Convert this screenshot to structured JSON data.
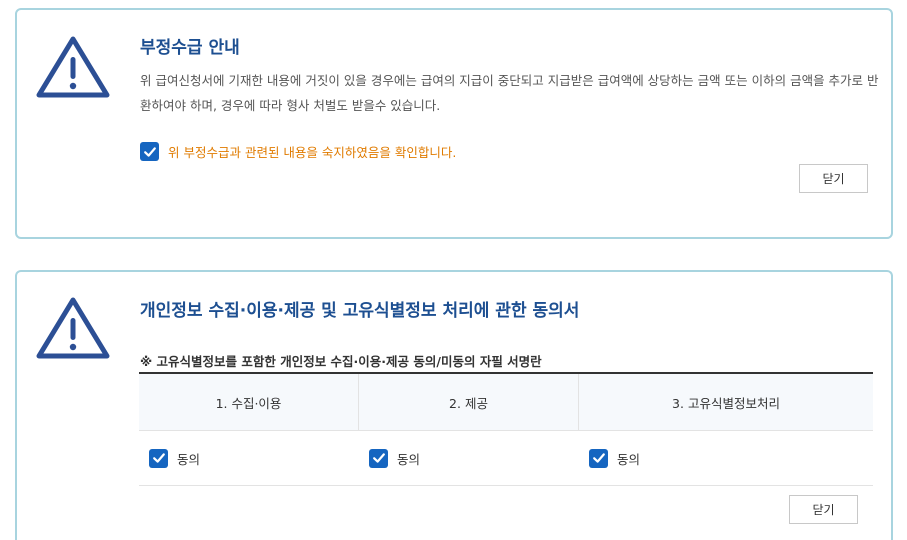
{
  "fraud_notice": {
    "title": "부정수급 안내",
    "text": "위 급여신청서에 기재한 내용에 거짓이 있을 경우에는 급여의 지급이 중단되고 지급받은 급여액에 상당하는 금액 또는 이하의 금액을 추가로 반환하여야 하며, 경우에 따라 형사 처벌도 받을수 있습니다.",
    "confirm_checked": true,
    "confirm_label": "위 부정수급과 관련된 내용을 숙지하였음을 확인합니다.",
    "close_label": "닫기"
  },
  "privacy_consent": {
    "title": "개인정보 수집·이용·제공 및 고유식별정보 처리에 관한 동의서",
    "sign_title": "※ 고유식별정보를 포함한 개인정보 수집·이용·제공 동의/미동의 자필 서명란",
    "columns": [
      "1. 수집·이용",
      "2. 제공",
      "3. 고유식별정보처리"
    ],
    "agree_label": "동의",
    "agree_checked": [
      true,
      true,
      true
    ],
    "close_label": "닫기"
  },
  "colors": {
    "title": "#1d4f91",
    "border": "#a8d4df",
    "checkbox": "#1565c0",
    "confirm_text": "#e07b00",
    "icon": "#2c4f95"
  },
  "icons": {
    "warning": "warning-triangle-icon",
    "check": "checkmark-icon"
  }
}
